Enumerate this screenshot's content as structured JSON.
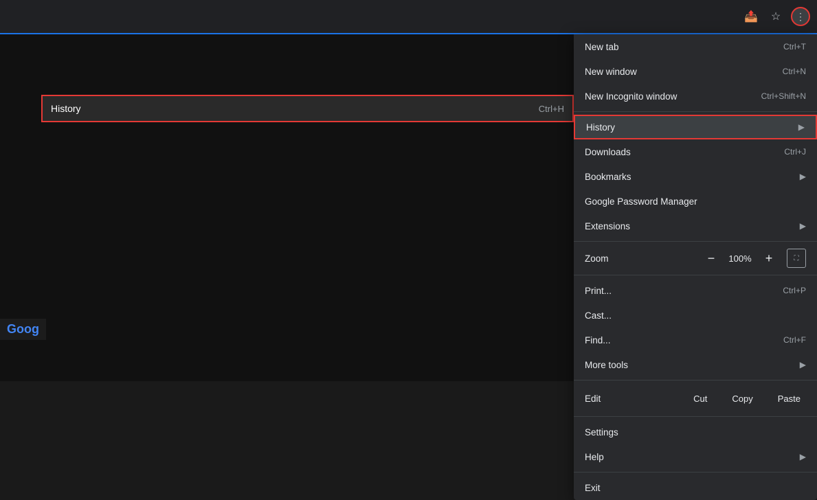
{
  "browser": {
    "toolbar": {
      "share_icon": "⬆",
      "bookmark_icon": "☆",
      "menu_icon": "⋮"
    }
  },
  "history_bar": {
    "label": "History",
    "shortcut": "Ctrl+H"
  },
  "google_logo": "Goog",
  "dropdown": {
    "items": [
      {
        "id": "new-tab",
        "label": "New tab",
        "shortcut": "Ctrl+T",
        "has_arrow": false
      },
      {
        "id": "new-window",
        "label": "New window",
        "shortcut": "Ctrl+N",
        "has_arrow": false
      },
      {
        "id": "new-incognito",
        "label": "New Incognito window",
        "shortcut": "Ctrl+Shift+N",
        "has_arrow": false
      },
      {
        "id": "history",
        "label": "History",
        "shortcut": "",
        "has_arrow": true,
        "highlighted": true
      },
      {
        "id": "downloads",
        "label": "Downloads",
        "shortcut": "Ctrl+J",
        "has_arrow": false
      },
      {
        "id": "bookmarks",
        "label": "Bookmarks",
        "shortcut": "",
        "has_arrow": true
      },
      {
        "id": "password-manager",
        "label": "Google Password Manager",
        "shortcut": "",
        "has_arrow": false
      },
      {
        "id": "extensions",
        "label": "Extensions",
        "shortcut": "",
        "has_arrow": true
      }
    ],
    "zoom": {
      "label": "Zoom",
      "minus": "−",
      "value": "100%",
      "plus": "+",
      "fullscreen_icon": "⛶"
    },
    "print": {
      "label": "Print...",
      "shortcut": "Ctrl+P"
    },
    "cast": {
      "label": "Cast...",
      "shortcut": ""
    },
    "find": {
      "label": "Find...",
      "shortcut": "Ctrl+F"
    },
    "more_tools": {
      "label": "More tools",
      "shortcut": "",
      "has_arrow": true
    },
    "edit": {
      "label": "Edit",
      "cut": "Cut",
      "copy": "Copy",
      "paste": "Paste"
    },
    "settings": {
      "label": "Settings",
      "shortcut": ""
    },
    "help": {
      "label": "Help",
      "shortcut": "",
      "has_arrow": true
    },
    "exit": {
      "label": "Exit",
      "shortcut": ""
    }
  }
}
